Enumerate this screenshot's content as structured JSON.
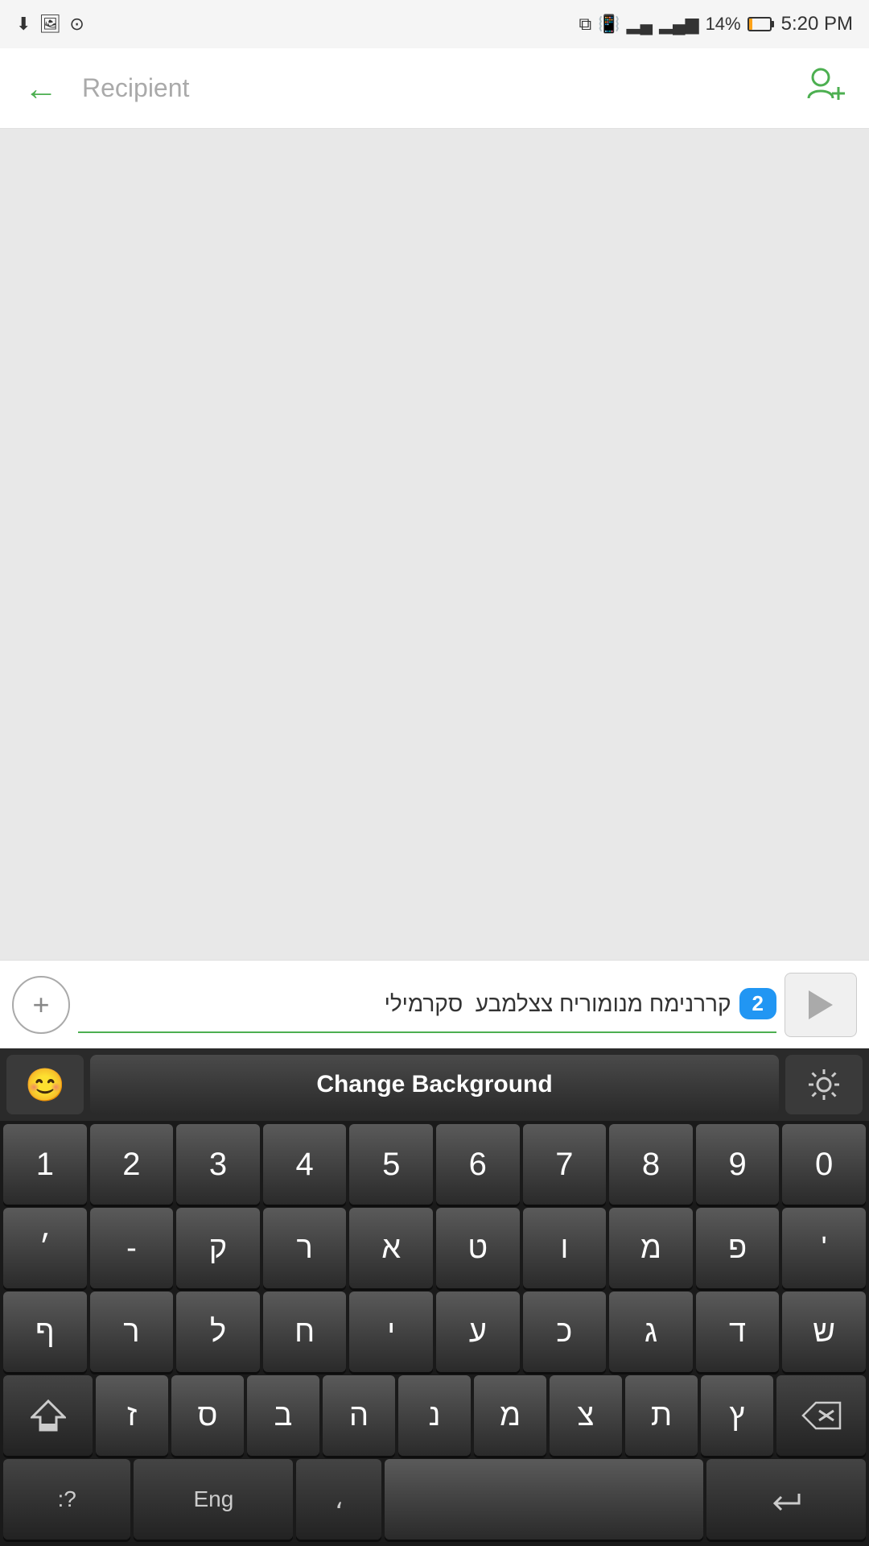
{
  "statusBar": {
    "time": "5:20 PM",
    "battery": "14%",
    "icons": {
      "download": "⬇",
      "image": "🖼",
      "circle": "⊙",
      "cast": "⧉",
      "vibrate": "📳",
      "signal1": "▂▄",
      "signal2": "▂▄▆",
      "batteryLevel": "14%"
    }
  },
  "navBar": {
    "backLabel": "←",
    "recipientPlaceholder": "Recipient",
    "addContactLabel": "👤+"
  },
  "messageBar": {
    "addButtonLabel": "+",
    "inputText": "קררנימח מנומוריח צצלמבע  סקרמילי",
    "badgeCount": "2",
    "sendButtonLabel": "➤"
  },
  "keyboard": {
    "topBar": {
      "emojiLabel": "😊",
      "changeBackgroundLabel": "Change Background",
      "settingsLabel": "⚙"
    },
    "rows": {
      "numbers": [
        "1",
        "2",
        "3",
        "4",
        "5",
        "6",
        "7",
        "8",
        "9",
        "0"
      ],
      "row1": [
        "פ",
        "מ",
        "ו",
        "ט",
        "א",
        "ר",
        "ק",
        "'",
        "-",
        "׳"
      ],
      "row2": [
        "ף",
        "ר",
        "ל",
        "ח",
        "י",
        "ע",
        "כ",
        "ג",
        "ד",
        "ש"
      ],
      "row3_special_left": "⇧",
      "row3": [
        "ז",
        "ס",
        "ב",
        "ה",
        "נ",
        "מ",
        "צ",
        "ת",
        "ץ"
      ],
      "row3_special_right": "⌫",
      "bottomBar": {
        "symbolsLabel": ":?",
        "langLabel": "Eng",
        "commaLabel": "،",
        "spaceLabel": "",
        "enterLabel": "↵"
      }
    }
  }
}
